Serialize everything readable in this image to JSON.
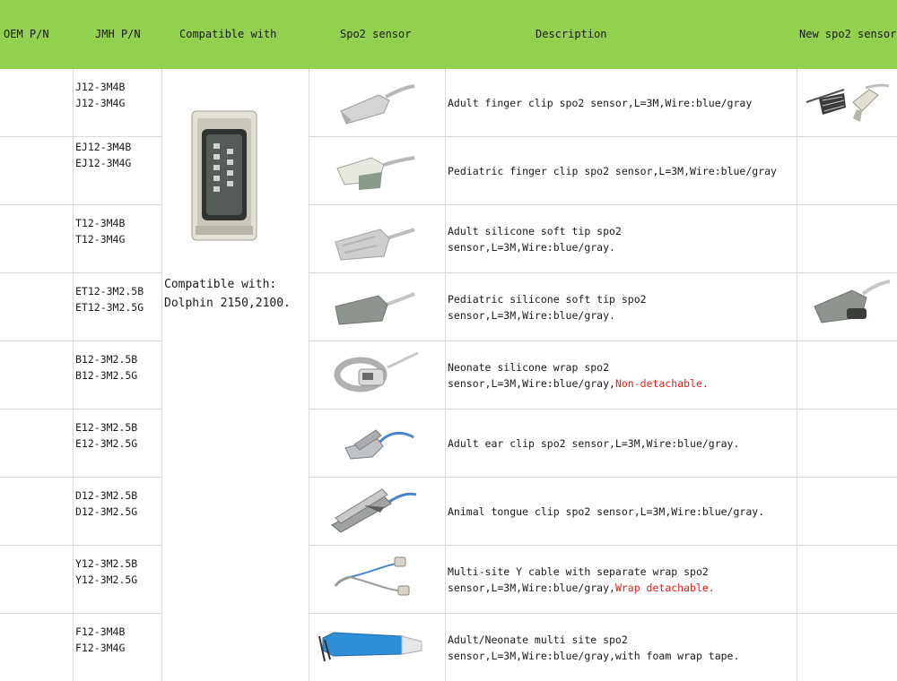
{
  "headers": {
    "oem_pn": "OEM P/N",
    "jmh_pn": "JMH P/N",
    "compatible": "Compatible with",
    "spo2_sensor": "Spo2 sensor",
    "description": "Description",
    "new_sensor": "New spo2 sensor"
  },
  "compatible": {
    "line1": "Compatible with:",
    "line2": "Dolphin 2150,2100."
  },
  "rows": [
    {
      "pn1": "J12-3M4B",
      "pn2": "J12-3M4G",
      "desc1": "Adult finger clip spo2 sensor,L=3M,Wire:blue/gray",
      "desc2": "",
      "note": ""
    },
    {
      "pn1": "EJ12-3M4B",
      "pn2": "EJ12-3M4G",
      "desc1": "Pediatric finger clip spo2 sensor,L=3M,Wire:blue/gray",
      "desc2": "",
      "note": ""
    },
    {
      "pn1": "T12-3M4B",
      "pn2": "T12-3M4G",
      "desc1": "Adult silicone soft tip spo2",
      "desc2": "sensor,L=3M,Wire:blue/gray.",
      "note": ""
    },
    {
      "pn1": "ET12-3M2.5B",
      "pn2": "ET12-3M2.5G",
      "desc1": "Pediatric silicone soft tip spo2",
      "desc2": "sensor,L=3M,Wire:blue/gray.",
      "note": ""
    },
    {
      "pn1": "B12-3M2.5B",
      "pn2": "B12-3M2.5G",
      "desc1": "Neonate silicone wrap spo2",
      "desc2": "sensor,L=3M,Wire:blue/gray,",
      "note": "Non-detachable."
    },
    {
      "pn1": "E12-3M2.5B",
      "pn2": "E12-3M2.5G",
      "desc1": "Adult ear clip spo2 sensor,L=3M,Wire:blue/gray.",
      "desc2": "",
      "note": ""
    },
    {
      "pn1": "D12-3M2.5B",
      "pn2": "D12-3M2.5G",
      "desc1": "Animal tongue clip spo2 sensor,L=3M,Wire:blue/gray.",
      "desc2": "",
      "note": ""
    },
    {
      "pn1": "Y12-3M2.5B",
      "pn2": "Y12-3M2.5G",
      "desc1": "Multi-site Y cable with separate wrap spo2",
      "desc2": "sensor,L=3M,Wire:blue/gray,",
      "note": "Wrap detachable."
    },
    {
      "pn1": "F12-3M4B",
      "pn2": "F12-3M4G",
      "desc1": "Adult/Neonate multi site spo2",
      "desc2": "sensor,L=3M,Wire:blue/gray,with foam wrap tape.",
      "note": ""
    }
  ],
  "icons": {
    "connector": "db9-connector-icon",
    "sensors": [
      "finger-clip-sensor-icon",
      "pediatric-finger-clip-icon",
      "soft-tip-sensor-icon",
      "pediatric-soft-tip-icon",
      "neonate-wrap-sensor-icon",
      "ear-clip-sensor-icon",
      "tongue-clip-sensor-icon",
      "y-cable-sensor-icon",
      "multi-site-wrap-sensor-icon"
    ]
  },
  "colors": {
    "header_bg": "#92d050",
    "grid": "#d9d9d9",
    "note_red": "#e0201a",
    "wire_blue": "#4a86c5",
    "foam_blue": "#2e8fd6"
  }
}
